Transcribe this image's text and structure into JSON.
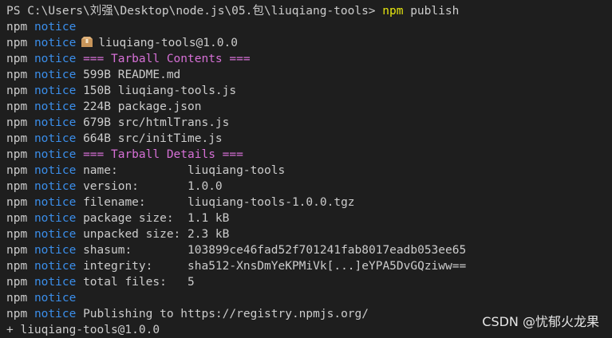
{
  "prompt": {
    "prefix": "PS C:\\Users\\刘强\\Desktop\\node.js\\05.包\\liuqiang-tools>",
    "command": "npm",
    "args": "publish"
  },
  "labels": {
    "npm": "npm",
    "notice": "notice"
  },
  "lines": [
    {
      "text": ""
    },
    {
      "text": "liuqiang-tools@1.0.0",
      "icon": "package-icon"
    },
    {
      "text": "=== Tarball Contents ===",
      "magenta": true
    },
    {
      "text": "599B README.md"
    },
    {
      "text": "150B liuqiang-tools.js"
    },
    {
      "text": "224B package.json"
    },
    {
      "text": "679B src/htmlTrans.js"
    },
    {
      "text": "664B src/initTime.js"
    },
    {
      "text": "=== Tarball Details ===",
      "magenta": true
    },
    {
      "text": "name:          liuqiang-tools"
    },
    {
      "text": "version:       1.0.0"
    },
    {
      "text": "filename:      liuqiang-tools-1.0.0.tgz"
    },
    {
      "text": "package size:  1.1 kB"
    },
    {
      "text": "unpacked size: 2.3 kB"
    },
    {
      "text": "shasum:        103899ce46fad52f701241fab8017eadb053ee65"
    },
    {
      "text": "integrity:     sha512-XnsDmYeKPMiVk[...]eYPA5DvGQziww=="
    },
    {
      "text": "total files:   5"
    },
    {
      "text": ""
    },
    {
      "text": "Publishing to https://registry.npmjs.org/"
    }
  ],
  "result": "+ liuqiang-tools@1.0.0",
  "watermark": "CSDN @忧郁火龙果",
  "colors": {
    "background": "#1e1e1e",
    "notice": "#3b8eea",
    "heading": "#d670d6",
    "command": "#e5e510",
    "text": "#cccccc"
  }
}
